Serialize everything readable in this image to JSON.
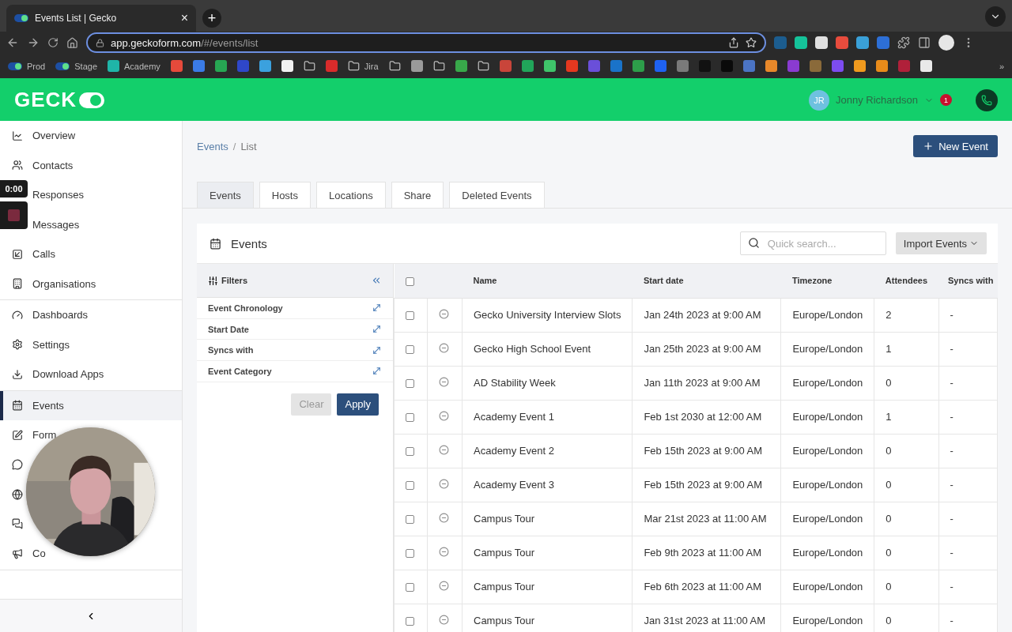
{
  "browser": {
    "tab_title": "Events List | Gecko",
    "tab_close": "×",
    "new_tab": "+",
    "url_host": "app.geckoform.com",
    "url_path": "/#/events/list",
    "more": "»",
    "bookmarks": [
      {
        "kind": "toggle",
        "label": "Prod",
        "color": "#5fe08a"
      },
      {
        "kind": "toggle",
        "label": "Stage",
        "color": "#5fe08a"
      },
      {
        "kind": "app",
        "label": "Academy",
        "color": "#1fb5a8"
      },
      {
        "kind": "app",
        "color": "#e64a3b"
      },
      {
        "kind": "app",
        "color": "#3b7be6"
      },
      {
        "kind": "app",
        "color": "#27a653"
      },
      {
        "kind": "app",
        "color": "#2f47c9"
      },
      {
        "kind": "app",
        "color": "#3ba1de"
      },
      {
        "kind": "app",
        "color": "#f2f2f2"
      },
      {
        "kind": "folder"
      },
      {
        "kind": "app",
        "color": "#d92b2b"
      },
      {
        "kind": "folder",
        "label": "Jira"
      },
      {
        "kind": "folder"
      },
      {
        "kind": "app",
        "color": "#9a9a9a"
      },
      {
        "kind": "folder"
      },
      {
        "kind": "app",
        "color": "#38a84a"
      },
      {
        "kind": "folder"
      },
      {
        "kind": "app",
        "color": "#c9453a"
      },
      {
        "kind": "app",
        "color": "#21a55a"
      },
      {
        "kind": "app",
        "color": "#3fc46a"
      },
      {
        "kind": "app",
        "color": "#e5381f"
      },
      {
        "kind": "app",
        "color": "#6a4fd9"
      },
      {
        "kind": "app",
        "color": "#1a73c9"
      },
      {
        "kind": "app",
        "color": "#2d9e4a"
      },
      {
        "kind": "app",
        "color": "#1f62f2"
      },
      {
        "kind": "app",
        "color": "#7a7a7a"
      },
      {
        "kind": "app",
        "color": "#111111"
      },
      {
        "kind": "app",
        "color": "#0a0a0a"
      },
      {
        "kind": "app",
        "color": "#4b74c4"
      },
      {
        "kind": "app",
        "color": "#e8882a"
      },
      {
        "kind": "app",
        "color": "#8a3bd1"
      },
      {
        "kind": "app",
        "color": "#8a6a3a"
      },
      {
        "kind": "app",
        "color": "#7d4cf0"
      },
      {
        "kind": "app",
        "color": "#f09a1e"
      },
      {
        "kind": "app",
        "color": "#e88b1a"
      },
      {
        "kind": "app",
        "color": "#b0203a"
      },
      {
        "kind": "app",
        "color": "#e9e9e9"
      }
    ]
  },
  "header": {
    "logo": "GECK",
    "user": {
      "initials": "JR",
      "name": "Jonny Richardson",
      "notifications": "1"
    }
  },
  "recorder": {
    "time": "0:00"
  },
  "sidebar": {
    "groups": [
      [
        {
          "label": "Overview",
          "selected": false
        },
        {
          "label": "Contacts",
          "selected": false
        },
        {
          "label": "Responses",
          "selected": false
        },
        {
          "label": "Messages",
          "selected": false
        },
        {
          "label": "Calls",
          "selected": false
        },
        {
          "label": "Organisations",
          "selected": false
        }
      ],
      [
        {
          "label": "Dashboards",
          "selected": false
        },
        {
          "label": "Settings",
          "selected": false
        },
        {
          "label": "Download Apps",
          "selected": false
        }
      ],
      [
        {
          "label": "Events",
          "selected": true
        },
        {
          "label": "Form",
          "selected": false
        },
        {
          "selected": false
        },
        {
          "selected": false
        },
        {
          "selected": false
        },
        {
          "label": "Co",
          "selected": false
        }
      ]
    ]
  },
  "breadcrumb": [
    {
      "label": "Events"
    },
    {
      "label": "/"
    },
    {
      "label": "List"
    }
  ],
  "new_event_button": "New Event",
  "tabs": [
    {
      "label": "Events",
      "selected": true
    },
    {
      "label": "Hosts",
      "selected": false
    },
    {
      "label": "Locations",
      "selected": false
    },
    {
      "label": "Share",
      "selected": false
    },
    {
      "label": "Deleted Events",
      "selected": false
    }
  ],
  "card": {
    "title": "Events",
    "search": {
      "placeholder": "Quick search..."
    },
    "import_button": "Import Events",
    "filters": {
      "title": "Filters",
      "items": [
        "Event Chronology",
        "Start Date",
        "Syncs with",
        "Event Category"
      ],
      "clear": {
        "label": "Clear",
        "disabled": true
      },
      "apply": "Apply"
    },
    "table": {
      "all_checked": false,
      "columns": [
        "Name",
        "Start date",
        "Timezone",
        "Attendees",
        "Syncs with"
      ],
      "rows": [
        {
          "checked": false,
          "cells": [
            "Gecko University Interview Slots",
            "Jan 24th 2023 at 9:00 AM",
            "Europe/London",
            "2",
            "-"
          ]
        },
        {
          "checked": false,
          "cells": [
            "Gecko High School Event",
            "Jan 25th 2023 at 9:00 AM",
            "Europe/London",
            "1",
            "-"
          ]
        },
        {
          "checked": false,
          "cells": [
            "AD Stability Week",
            "Jan 11th 2023 at 9:00 AM",
            "Europe/London",
            "0",
            "-"
          ]
        },
        {
          "checked": false,
          "cells": [
            "Academy Event 1",
            "Feb 1st 2030 at 12:00 AM",
            "Europe/London",
            "1",
            "-"
          ]
        },
        {
          "checked": false,
          "cells": [
            "Academy Event 2",
            "Feb 15th 2023 at 9:00 AM",
            "Europe/London",
            "0",
            "-"
          ]
        },
        {
          "checked": false,
          "cells": [
            "Academy Event 3",
            "Feb 15th 2023 at 9:00 AM",
            "Europe/London",
            "0",
            "-"
          ]
        },
        {
          "checked": false,
          "cells": [
            "Campus Tour",
            "Mar 21st 2023 at 11:00 AM",
            "Europe/London",
            "0",
            "-"
          ]
        },
        {
          "checked": false,
          "cells": [
            "Campus Tour",
            "Feb 9th 2023 at 11:00 AM",
            "Europe/London",
            "0",
            "-"
          ]
        },
        {
          "checked": false,
          "cells": [
            "Campus Tour",
            "Feb 6th 2023 at 11:00 AM",
            "Europe/London",
            "0",
            "-"
          ]
        },
        {
          "checked": false,
          "cells": [
            "Campus Tour",
            "Jan 31st 2023 at 11:00 AM",
            "Europe/London",
            "0",
            "-"
          ]
        }
      ]
    }
  }
}
